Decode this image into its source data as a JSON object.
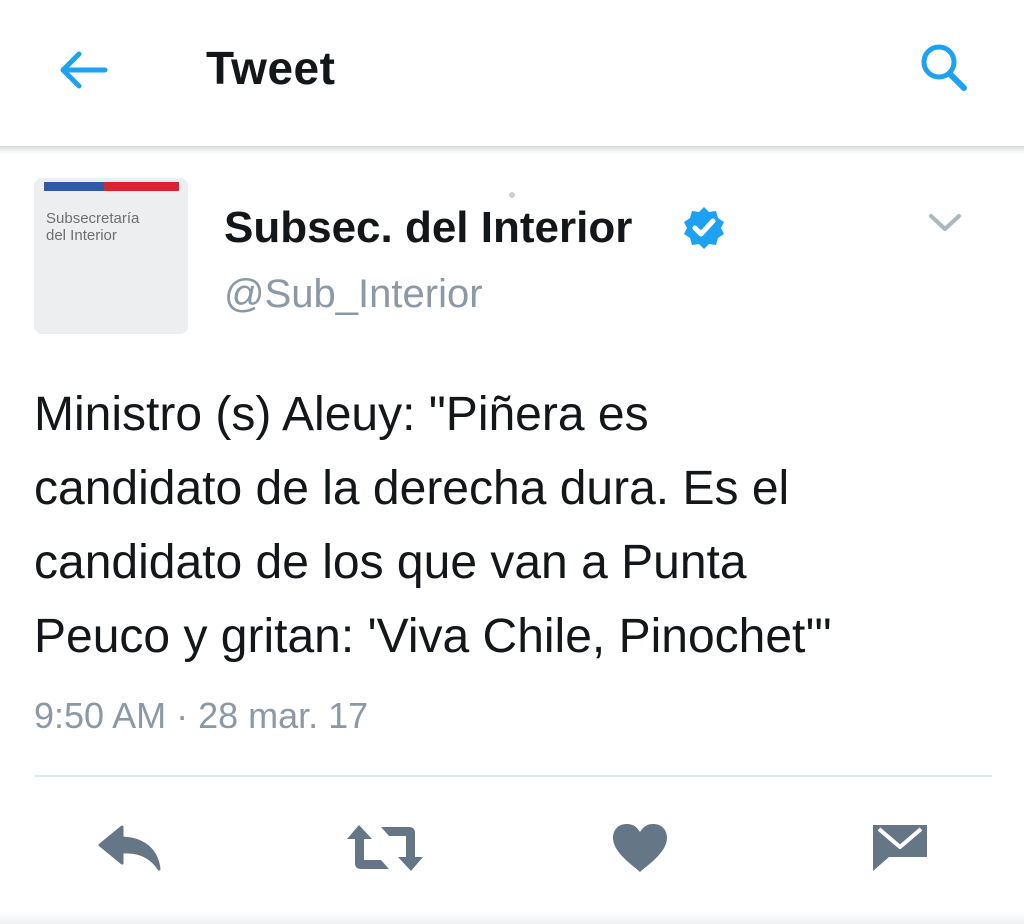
{
  "header": {
    "title": "Tweet",
    "back_icon": "arrow-left-icon",
    "search_icon": "search-icon",
    "accent_color": "#1da1f2"
  },
  "author": {
    "avatar_text": "Subsecretaría\ndel Interior",
    "name": "Subsec. del Interior",
    "handle": "@Sub_Interior",
    "verified": true,
    "verified_color": "#1da1f2"
  },
  "tweet": {
    "lines": [
      "Ministro (s) Aleuy: \"Piñera es",
      "candidato de la derecha dura. Es el",
      "candidato de los que van a Punta",
      "Peuco y gritan: 'Viva Chile, Pinochet'\""
    ],
    "timestamp": "9:50 AM · 28 mar. 17"
  },
  "actions": [
    {
      "name": "reply",
      "icon": "reply-icon"
    },
    {
      "name": "retweet",
      "icon": "retweet-icon"
    },
    {
      "name": "like",
      "icon": "heart-icon"
    },
    {
      "name": "direct-message",
      "icon": "envelope-icon"
    }
  ],
  "colors": {
    "icon_gray": "#657786",
    "secondary_text": "#8b98a5",
    "primary_text": "#14171a"
  }
}
